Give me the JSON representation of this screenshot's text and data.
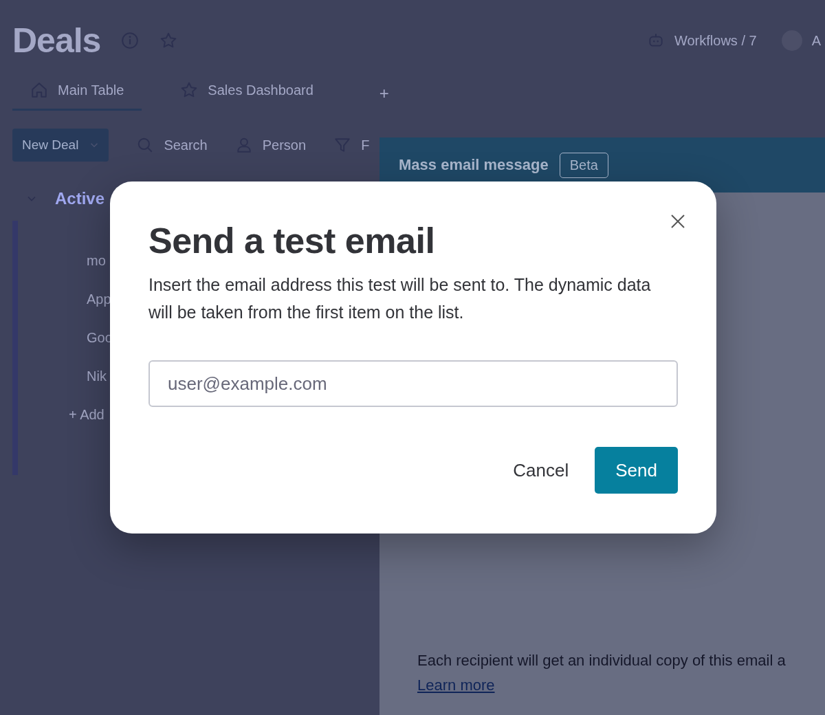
{
  "board": {
    "title": "Deals",
    "workflows": "Workflows / 7",
    "avatar_initial": "A"
  },
  "tabs": [
    {
      "label": "Main Table",
      "selected": true
    },
    {
      "label": "Sales Dashboard",
      "selected": false
    }
  ],
  "add_tab": "+",
  "toolbar": {
    "new_button": "New Deal",
    "items": [
      {
        "label": "Search"
      },
      {
        "label": "Person"
      },
      {
        "label": "F"
      }
    ]
  },
  "group": {
    "title": "Active",
    "rows": [
      "mo",
      "App",
      "Goo",
      "Nik"
    ],
    "add_row": "+ Add"
  },
  "side_panel": {
    "title": "Mass email message",
    "badge": "Beta",
    "note": "Each recipient will get an individual copy of this email a",
    "link": "Learn more"
  },
  "dialog": {
    "title": "Send a test email",
    "message": "Insert the email address this test will be sent to. The dynamic data will be taken from the first item on the list.",
    "placeholder": "user@example.com",
    "buttons": [
      {
        "label": "Cancel",
        "kind": "secondary"
      },
      {
        "label": "Send",
        "kind": "primary"
      }
    ]
  }
}
